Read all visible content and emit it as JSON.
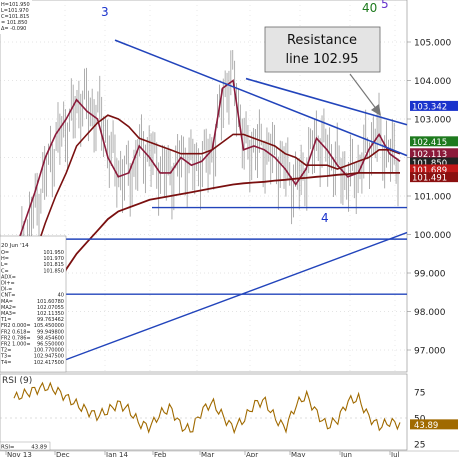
{
  "chart_data": {
    "type": "line",
    "price_axis": {
      "ylim": [
        96.4,
        105.6
      ],
      "ticks": [
        "105.000",
        "104.000",
        "103.000",
        "102.000",
        "101.000",
        "100.000",
        "99.000",
        "98.000",
        "97.000"
      ]
    },
    "rsi_axis": {
      "ylim": [
        20,
        85
      ],
      "ticks": [
        "75",
        "50",
        "25"
      ]
    },
    "x_labels": [
      "Nov 13",
      "Dec",
      "Jan 14",
      "Feb",
      "Mar",
      "Apr",
      "May",
      "Jun",
      "Jul"
    ],
    "price_badges": [
      {
        "text": "103.342",
        "value": 103.34,
        "color": "#1a33cc"
      },
      {
        "text": "102.415",
        "value": 102.42,
        "color": "#1e7a1e"
      },
      {
        "text": "102.113",
        "value": 102.11,
        "color": "#8b1a3a"
      },
      {
        "text": "101.850",
        "value": 101.87,
        "color": "#222222"
      },
      {
        "text": "101.689",
        "value": 101.69,
        "color": "#c01818"
      },
      {
        "text": "101.491",
        "value": 101.49,
        "color": "#8b1010"
      }
    ],
    "rsi_badge": {
      "text": "43.89",
      "value": 43.89,
      "color": "#a06a00"
    },
    "annotation": {
      "line1": "Resistance",
      "line2": "line 102.95"
    },
    "wave_labels": [
      {
        "text": "3",
        "color": "#1a33cc"
      },
      {
        "text": "4",
        "color": "#1a33cc"
      },
      {
        "text": "40",
        "color": "#1e7a1e"
      },
      {
        "text": "5",
        "color": "#6633cc"
      }
    ],
    "rsi_label": "RSI (9)",
    "data_box": {
      "date": "20 Jun '14",
      "rows": [
        {
          "k": "O=",
          "v": "101.950"
        },
        {
          "k": "H=",
          "v": "101.970"
        },
        {
          "k": "L=",
          "v": "101.815"
        },
        {
          "k": "C=",
          "v": "101.850"
        },
        {
          "k": "ADX=",
          "v": ""
        },
        {
          "k": "DI+=",
          "v": ""
        },
        {
          "k": "DI-=",
          "v": ""
        },
        {
          "k": "CNT=",
          "v": "40"
        },
        {
          "k": "MA=",
          "v": "101.60780"
        },
        {
          "k": "MA2=",
          "v": "102.07055"
        },
        {
          "k": "MA3=",
          "v": "102.11350"
        },
        {
          "k": "T1=",
          "v": "99.763462"
        },
        {
          "k": "FR2 0.000=",
          "v": "105.450000"
        },
        {
          "k": "FR2 0.618=",
          "v": "99.949800"
        },
        {
          "k": "FR2 0.786=",
          "v": "98.454600"
        },
        {
          "k": "FR2 1.000=",
          "v": "96.550000"
        },
        {
          "k": "T2=",
          "v": "100.770000"
        },
        {
          "k": "T3=",
          "v": "102.947500"
        },
        {
          "k": "T4=",
          "v": "102.417500"
        }
      ],
      "rsi_readout": "43.89"
    },
    "top_left": {
      "lines": [
        "H=101.950",
        "L=101.970",
        "C=101.815",
        "= 101.850",
        "Δ= -0.090"
      ]
    },
    "series": [
      {
        "values": [
          99.5,
          100.3,
          101.1,
          102.0,
          102.6,
          103.0,
          103.5,
          103.2,
          103.0,
          102.0,
          101.5,
          101.6,
          102.3,
          102.0,
          101.6,
          101.6,
          102.0,
          101.8,
          101.9,
          102.2,
          103.8,
          104.0,
          102.2,
          102.3,
          102.2,
          102.0,
          101.7,
          101.3,
          101.7,
          102.5,
          102.2,
          101.8,
          101.5,
          101.6,
          102.2,
          102.6,
          102.1,
          101.9
        ]
      },
      {
        "values": [
          98.4,
          98.9,
          99.5,
          100.3,
          101.0,
          101.6,
          102.3,
          102.6,
          102.9,
          103.1,
          103.0,
          102.8,
          102.5,
          102.4,
          102.3,
          102.2,
          102.1,
          102.1,
          102.1,
          102.2,
          102.4,
          102.6,
          102.6,
          102.5,
          102.4,
          102.3,
          102.1,
          102.0,
          101.8,
          101.8,
          101.8,
          101.7,
          101.8,
          101.9,
          102.0,
          102.2,
          102.2,
          102.1
        ]
      },
      {
        "values": [
          96.5,
          96.7,
          97.1,
          97.8,
          98.5,
          99.1,
          99.5,
          99.8,
          100.1,
          100.4,
          100.6,
          100.7,
          100.8,
          100.9,
          100.95,
          101.0,
          101.05,
          101.1,
          101.15,
          101.2,
          101.25,
          101.3,
          101.33,
          101.35,
          101.37,
          101.4,
          101.42,
          101.45,
          101.47,
          101.5,
          101.52,
          101.55,
          101.57,
          101.6,
          101.6,
          101.6,
          101.6,
          101.6
        ]
      },
      {
        "values": [
          69,
          73,
          77,
          80,
          77,
          70,
          63,
          57,
          52,
          57,
          64,
          58,
          45,
          41,
          54,
          60,
          42,
          38,
          57,
          65,
          52,
          40,
          48,
          63,
          67,
          50,
          40,
          62,
          72,
          55,
          42,
          48,
          66,
          69,
          51,
          42,
          46,
          44
        ]
      }
    ]
  }
}
